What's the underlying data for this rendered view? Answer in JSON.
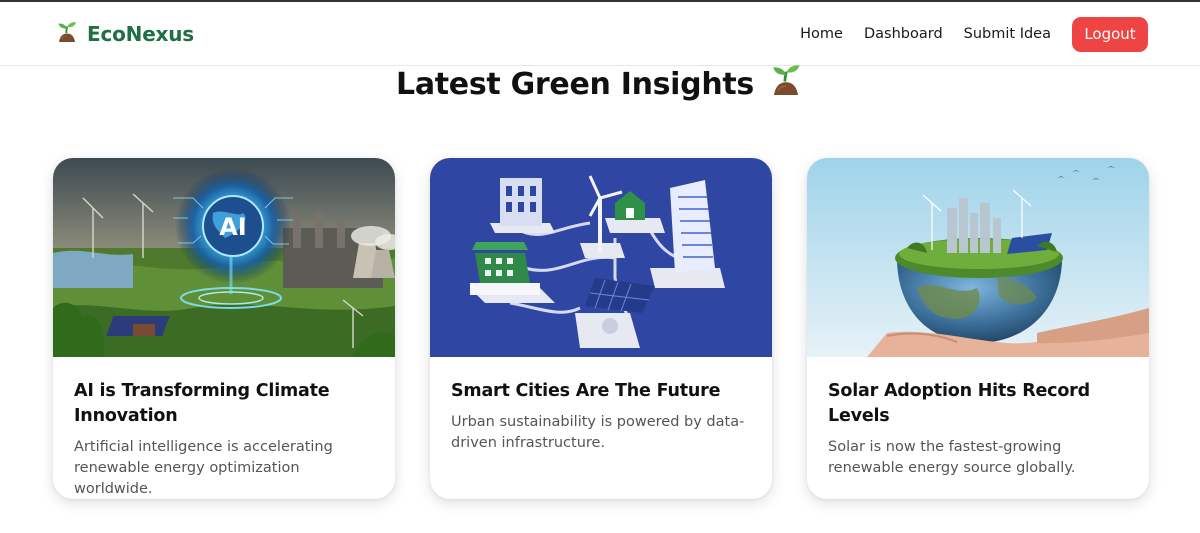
{
  "nav": {
    "brand_icon": "seedling-icon",
    "brand_name": "EcoNexus",
    "links": [
      "Home",
      "Dashboard",
      "Submit Idea"
    ],
    "logout_label": "Logout",
    "logout_color": "#ef4444",
    "brand_color": "#1f6f45"
  },
  "page": {
    "title": "Latest Green Insights",
    "title_icon": "seedling-icon"
  },
  "cards": [
    {
      "image": "ai-climate-city-illustration",
      "title": "AI is Transforming Climate Innovation",
      "description": "Artificial intelligence is accelerating renewable energy optimization worldwide."
    },
    {
      "image": "smart-city-isometric-illustration",
      "title": "Smart Cities Are The Future",
      "description": "Urban sustainability is powered by data-driven infrastructure."
    },
    {
      "image": "earth-in-hands-solar-illustration",
      "title": "Solar Adoption Hits Record Levels",
      "description": "Solar is now the fastest-growing renewable energy source globally."
    }
  ]
}
